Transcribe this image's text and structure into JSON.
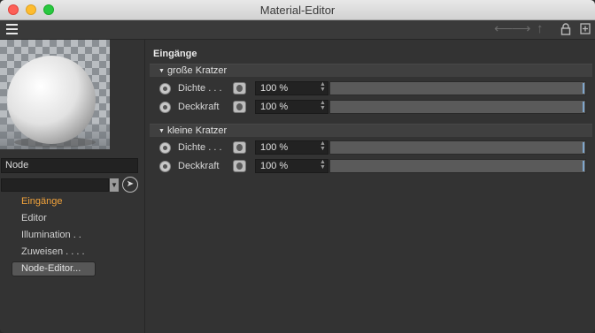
{
  "window": {
    "title": "Material-Editor"
  },
  "toolbar": {
    "back_icon": "arrow-left-icon",
    "forward_icon": "arrow-right-icon",
    "up_icon": "arrow-up-icon",
    "lock_icon": "lock-icon",
    "new_window_icon": "new-window-icon"
  },
  "left": {
    "node_name": "Node",
    "nav": [
      {
        "label": "Eingänge",
        "active": true
      },
      {
        "label": "Editor",
        "active": false
      },
      {
        "label": "Illumination  . .",
        "active": false
      },
      {
        "label": "Zuweisen . . . .",
        "active": false
      }
    ],
    "node_editor_button": "Node-Editor..."
  },
  "main": {
    "section_title": "Eingänge",
    "groups": [
      {
        "title": "große Kratzer",
        "rows": [
          {
            "label": "Dichte . . .",
            "value": "100 %",
            "level": 1.0
          },
          {
            "label": "Deckkraft",
            "value": "100 %",
            "level": 1.0
          }
        ]
      },
      {
        "title": "kleine Kratzer",
        "rows": [
          {
            "label": "Dichte . . .",
            "value": "100 %",
            "level": 1.0
          },
          {
            "label": "Deckkraft",
            "value": "100 %",
            "level": 1.0
          }
        ]
      }
    ]
  },
  "colors": {
    "accent_active": "#f2a33b",
    "slider_handle": "#7fa6cc",
    "background": "#333333"
  }
}
